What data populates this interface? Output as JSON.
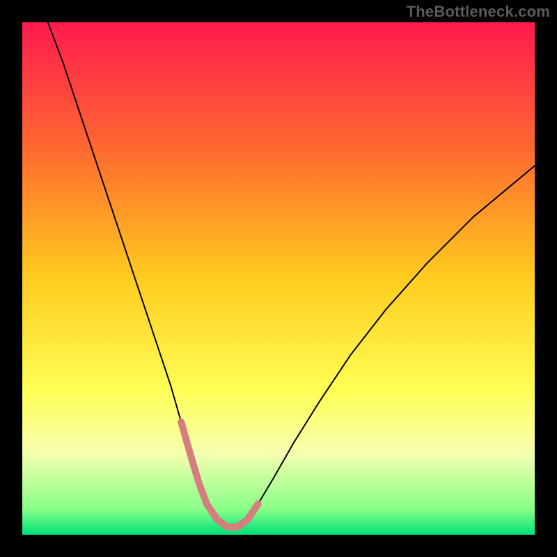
{
  "watermark": "TheBottleneck.com",
  "chart_data": {
    "type": "line",
    "title": "",
    "xlabel": "",
    "ylabel": "",
    "xlim": [
      0,
      100
    ],
    "ylim": [
      0,
      100
    ],
    "gradient_stops": [
      {
        "pos": 0.0,
        "color": "#ff1a4f"
      },
      {
        "pos": 0.25,
        "color": "#ff6a2f"
      },
      {
        "pos": 0.5,
        "color": "#ffcc1f"
      },
      {
        "pos": 0.72,
        "color": "#ffff55"
      },
      {
        "pos": 0.84,
        "color": "#f7ffb0"
      },
      {
        "pos": 0.95,
        "color": "#88ff88"
      },
      {
        "pos": 1.0,
        "color": "#00e07a"
      }
    ],
    "series": [
      {
        "name": "bottleneck-curve",
        "color": "#000000",
        "width": 2,
        "x": [
          5,
          8,
          11,
          14,
          17,
          20,
          23,
          26,
          29,
          31,
          33,
          34.5,
          36,
          38,
          40,
          42,
          44,
          46,
          49,
          53,
          58,
          64,
          71,
          79,
          88,
          100
        ],
        "y": [
          100,
          92,
          83,
          74,
          65,
          56,
          47,
          38,
          29,
          22,
          15,
          10,
          6,
          3,
          1.5,
          1.5,
          3,
          6,
          11,
          18,
          26,
          35,
          44,
          53,
          62,
          72
        ]
      },
      {
        "name": "highlight-band",
        "color": "#d67d7d",
        "width": 10,
        "x": [
          31,
          33,
          34.5,
          36,
          38,
          40,
          42,
          44,
          46
        ],
        "y": [
          22,
          15,
          10,
          6,
          3,
          1.5,
          1.5,
          3,
          6
        ]
      }
    ]
  }
}
